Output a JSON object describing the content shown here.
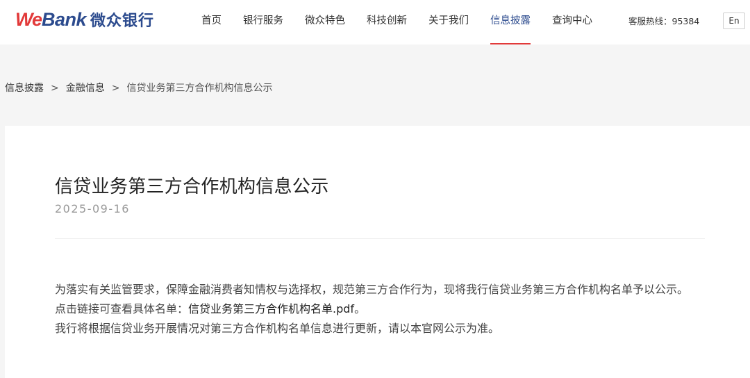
{
  "header": {
    "logo": {
      "we": "We",
      "bank": "Bank",
      "cn": "微众银行"
    },
    "nav": [
      {
        "label": "首页"
      },
      {
        "label": "银行服务"
      },
      {
        "label": "微众特色"
      },
      {
        "label": "科技创新"
      },
      {
        "label": "关于我们"
      },
      {
        "label": "信息披露",
        "active": true
      },
      {
        "label": "查询中心"
      }
    ],
    "hotline": "客服热线：95384",
    "lang_button": "En"
  },
  "breadcrumb": {
    "items": [
      "信息披露",
      "金融信息",
      "信贷业务第三方合作机构信息公示"
    ],
    "separator": ">"
  },
  "article": {
    "title": "信贷业务第三方合作机构信息公示",
    "date": "2025-09-16",
    "paragraph1": "为落实有关监管要求，保障金融消费者知情权与选择权，规范第三方合作行为，现将我行信贷业务第三方合作机构名单予以公示。",
    "paragraph2_prefix": "点击链接可查看具体名单：",
    "paragraph2_link": "信贷业务第三方合作机构名单.pdf",
    "paragraph2_suffix": "。",
    "paragraph3": "我行将根据信贷业务开展情况对第三方合作机构名单信息进行更新，请以本官网公示为准。"
  },
  "colors": {
    "brand_red": "#e23a3a",
    "brand_blue": "#2c4b8e",
    "page_bg": "#f5f5f5"
  }
}
